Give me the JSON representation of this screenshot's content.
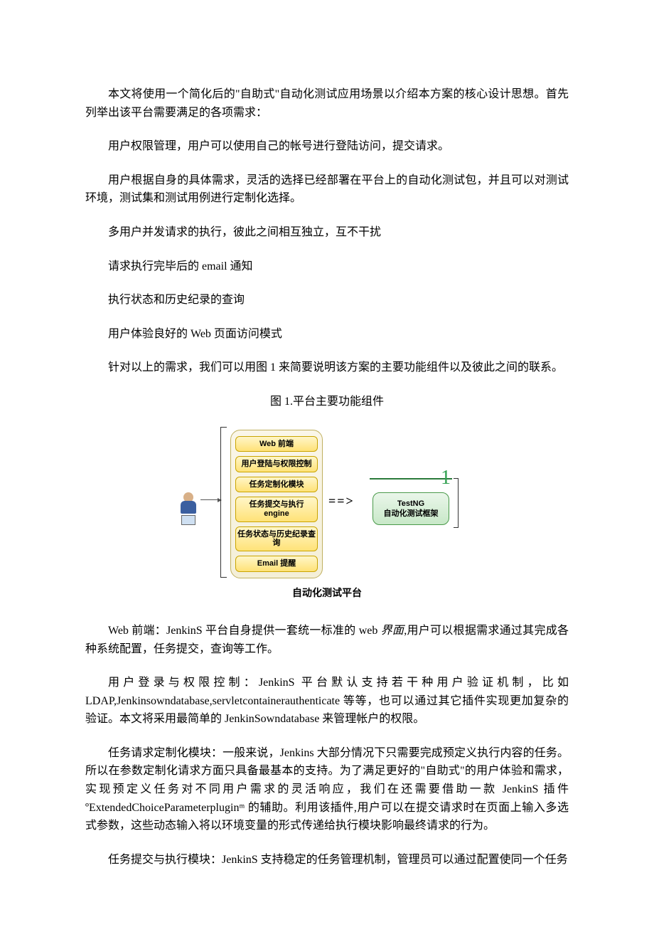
{
  "paragraphs": {
    "intro": "本文将使用一个简化后的\"自助式\"自动化测试应用场景以介绍本方案的核心设计思想。首先列举出该平台需要满足的各项需求：",
    "req1": "用户权限管理，用户可以使用自己的帐号进行登陆访问，提交请求。",
    "req2": "用户根据自身的具体需求，灵活的选择已经部署在平台上的自动化测试包，并且可以对测试环境，测试集和测试用例进行定制化选择。",
    "req3": "多用户并发请求的执行，彼此之间相互独立，互不干扰",
    "req4": "请求执行完毕后的 email 通知",
    "req5": "执行状态和历史纪录的查询",
    "req6": "用户体验良好的 Web 页面访问模式",
    "lead_to_fig": "针对以上的需求，我们可以用图 1 来简要说明该方案的主要功能组件以及彼此之间的联系。",
    "fig_caption": "图 1.平台主要功能组件",
    "web_front_pre": "Web 前端：JenkinS 平台自身提供一套统一标准的 web ",
    "web_front_ital": "界面",
    "web_front_post": ",用户可以根据需求通过其完成各种系统配置，任务提交，查询等工作。",
    "auth": "用户登录与权限控制：JenkinS 平台默认支持若干种用户验证机制，比如LDAP,Jenkinsowndatabase,servletcontainerauthenticate 等等，也可以通过其它插件实现更加复杂的验证。本文将采用最简单的 JenkinSowndatabase 来管理帐户的权限。",
    "custom": "任务请求定制化模块：一般来说，Jenkins 大部分情况下只需要完成预定义执行内容的任务。所以在参数定制化请求方面只具备最基本的支持。为了满足更好的\"自助式\"的用户体验和需求，实现预定义任务对不同用户需求的灵活响应，我们在还需要借助一款 JenkinS 插件ºExtendedChoiceParameterpluginᵐ 的辅助。利用该插件,用户可以在提交请求时在页面上输入多选式参数，这些动态输入将以环境变量的形式传递给执行模块影响最终请求的行为。",
    "submit": "任务提交与执行模块：JenkinS 支持稳定的任务管理机制，管理员可以通过配置使同一个任务"
  },
  "diagram": {
    "modules": [
      "Web 前端",
      "用户登陆与权限控制",
      "任务定制化模块",
      "任务提交与执行 engine",
      "任务状态与历史纪录查询",
      "Email 提醒"
    ],
    "arrow": "==>",
    "right_num": "1",
    "right_box_line1": "TestNG",
    "right_box_line2": "自动化测试框架",
    "bottom_caption": "自动化测试平台"
  }
}
